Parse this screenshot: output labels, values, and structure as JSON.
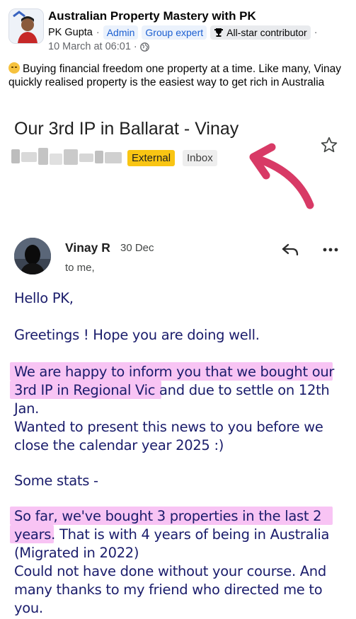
{
  "post": {
    "group_name": "Australian Property Mastery with PK",
    "author": "PK Gupta",
    "badges": [
      "Admin",
      "Group expert",
      "All-star contributor"
    ],
    "timestamp": "10 March at 06:01",
    "caption": "Buying financial freedom one property at a time. Like many, Vinay quickly realised property is the easiest way to get rich in Australia"
  },
  "email": {
    "subject": "Our 3rd IP in Ballarat - Vinay",
    "labels": {
      "external": "External",
      "inbox": "Inbox"
    },
    "sender_name": "Vinay R",
    "date": "30 Dec",
    "to": "to me,",
    "body": [
      "Hello PK,",
      "Greetings ! Hope you are doing well.",
      "We are happy to inform you that we bought our",
      "3rd IP in Regional Vic and due to settle on 12th",
      "Jan.",
      "Wanted to present this news to you before we",
      "close the calendar year 2025 :)",
      "Some stats -",
      "So far, we've bought 3 properties in the last 2",
      "years. That is with 4 years of being in Australia",
      "(Migrated in 2022)",
      "Could not have done without your course. And",
      "many thanks to my friend who directed me to",
      "you."
    ]
  },
  "colors": {
    "highlight": "#f6b0f0",
    "annotation_arrow": "#d83a66",
    "external_label": "#f9c513",
    "email_text": "#1a1c6b",
    "badge_blue": "#1c5fd1"
  }
}
